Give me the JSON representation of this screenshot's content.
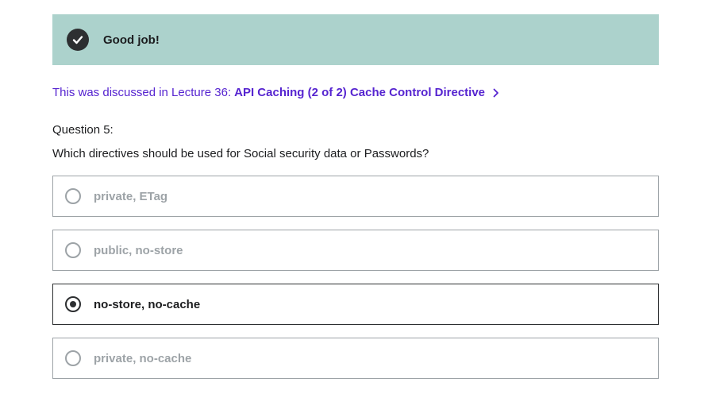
{
  "alert": {
    "icon": "check-circle-icon",
    "text": "Good job!",
    "background": "#acd2cc"
  },
  "lecture_ref": {
    "prefix": "This was discussed in Lecture 36:",
    "title": "API Caching (2 of 2) Cache Control Directive",
    "icon": "chevron-right-icon",
    "color": "#5624d0"
  },
  "question": {
    "number": "Question 5:",
    "text": "Which directives should be used for Social security data or Passwords?"
  },
  "options": [
    {
      "label": "private, ETag",
      "selected": false
    },
    {
      "label": "public, no-store",
      "selected": false
    },
    {
      "label": "no-store, no-cache",
      "selected": true
    },
    {
      "label": "private, no-cache",
      "selected": false
    }
  ]
}
